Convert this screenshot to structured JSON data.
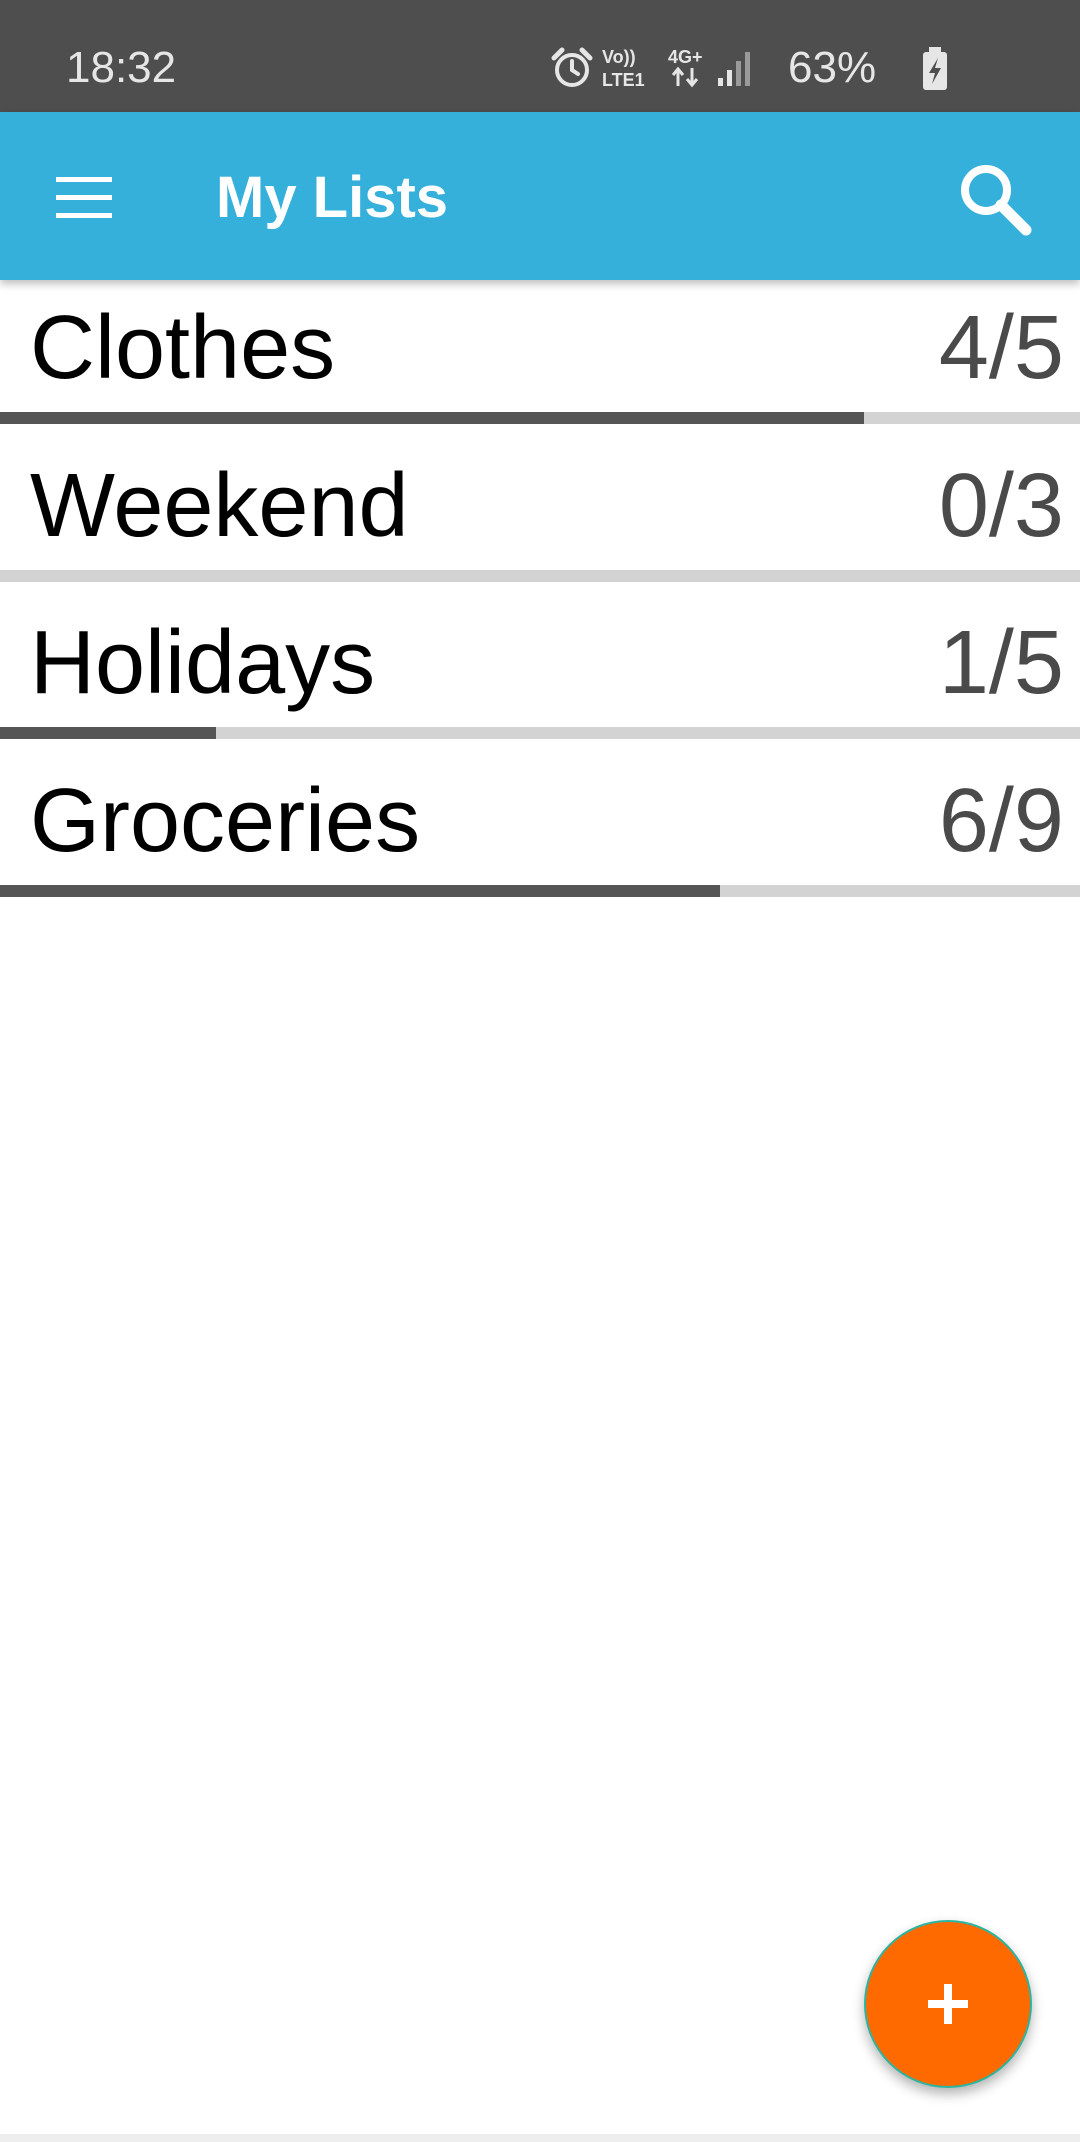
{
  "status_bar": {
    "time": "18:32",
    "battery_percent": "63%",
    "network": {
      "volte": "Vo))",
      "lte": "LTE1",
      "data": "4G+"
    },
    "icons": [
      "alarm-icon",
      "volte-icon",
      "4g-data-icon",
      "signal-icon",
      "battery-charging-icon"
    ]
  },
  "app_bar": {
    "title": "My Lists",
    "menu_icon": "hamburger-menu-icon",
    "search_icon": "search-icon"
  },
  "lists": [
    {
      "name": "Clothes",
      "count": "4/5",
      "progress": 0.8
    },
    {
      "name": "Weekend",
      "count": "0/3",
      "progress": 0.0
    },
    {
      "name": "Holidays",
      "count": "1/5",
      "progress": 0.2
    },
    {
      "name": "Groceries",
      "count": "6/9",
      "progress": 0.6667
    }
  ],
  "fab": {
    "icon": "plus-icon",
    "color": "#ff6a00"
  },
  "colors": {
    "app_bar": "#35b0db",
    "status_bar": "#4e4e4e",
    "progress_fill": "#555555",
    "progress_track": "#d3d3d3",
    "fab": "#ff6a00"
  }
}
